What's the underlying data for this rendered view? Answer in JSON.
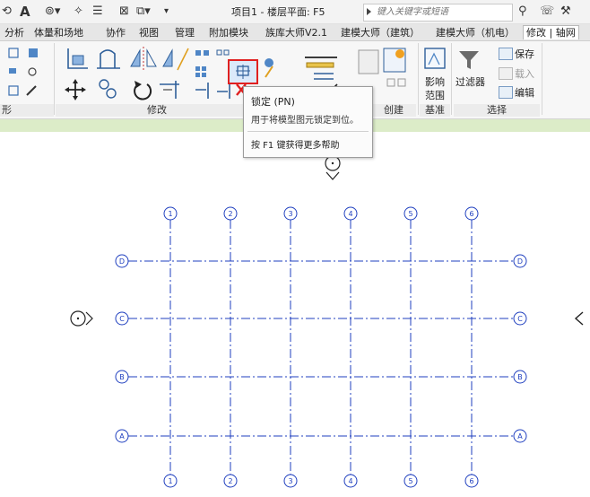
{
  "quick_access": {
    "title": "项目1 - 楼层平面: F5",
    "search_placeholder": "键入关键字或短语"
  },
  "tabs": [
    {
      "label": "分析"
    },
    {
      "label": "体量和场地"
    },
    {
      "label": "协作"
    },
    {
      "label": "视图"
    },
    {
      "label": "管理"
    },
    {
      "label": "附加模块"
    },
    {
      "label": "族库大师V2.1"
    },
    {
      "label": "建模大师（建筑）"
    },
    {
      "label": "建模大师（机电）"
    },
    {
      "label": "修改 | 轴网",
      "active": true
    }
  ],
  "ribbon": {
    "panels": {
      "left_fragment": "形",
      "modify": "修改",
      "create": "创建",
      "datum": "基准",
      "selection": "选择"
    },
    "buttons": {
      "scope_box_line1": "影响",
      "scope_box_line2": "范围",
      "filter": "过滤器",
      "save": "保存",
      "load": "载入",
      "edit": "编辑"
    },
    "highlighted_tool": "pin-tool"
  },
  "tooltip": {
    "title": "锁定 (PN)",
    "description": "用于将模型图元锁定到位。",
    "help": "按 F1 键获得更多帮助"
  },
  "grid": {
    "vertical_labels": [
      "1",
      "2",
      "3",
      "4",
      "5",
      "6"
    ],
    "horizontal_labels": [
      "D",
      "C",
      "B",
      "A"
    ],
    "line_color": "#1f3fbf"
  },
  "colors": {
    "highlight_red": "#e02020",
    "status_green": "#dcecc8"
  }
}
